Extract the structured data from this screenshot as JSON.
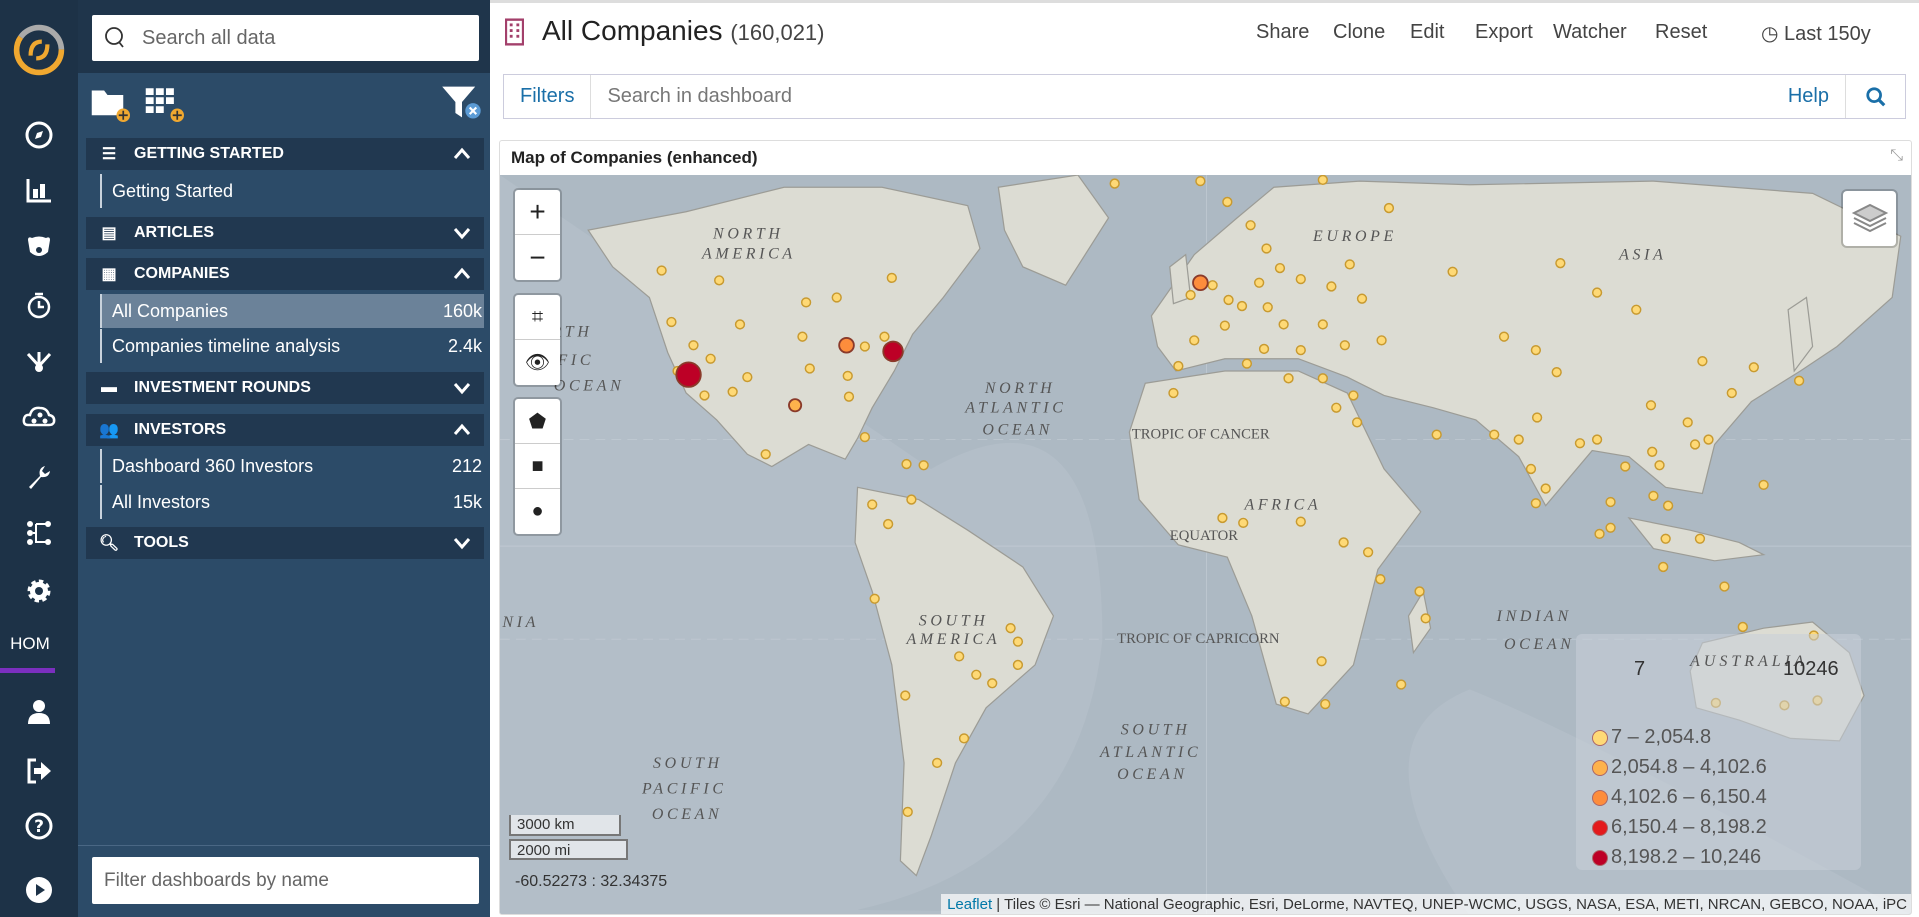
{
  "rail": {
    "logo": "siren-logo",
    "items": [
      "compass-icon",
      "chart-icon",
      "bear-icon",
      "timer-icon",
      "graph-merge-icon",
      "cloud-graph-icon",
      "wrench-icon",
      "network-icon",
      "gear-icon"
    ],
    "home_label": "HOM",
    "bottom": [
      "user-icon",
      "logout-icon",
      "help-icon",
      "play-icon"
    ],
    "accent": "#7b2fbf"
  },
  "sidebar": {
    "search_placeholder": "Search all data",
    "filter_placeholder": "Filter dashboards by name",
    "sections": [
      {
        "title": "GETTING STARTED",
        "expanded": true,
        "items": [
          {
            "label": "Getting Started",
            "count": ""
          }
        ]
      },
      {
        "title": "ARTICLES",
        "expanded": false,
        "items": []
      },
      {
        "title": "COMPANIES",
        "expanded": true,
        "items": [
          {
            "label": "All Companies",
            "count": "160k",
            "selected": true
          },
          {
            "label": "Companies timeline analysis",
            "count": "2.4k"
          }
        ]
      },
      {
        "title": "INVESTMENT ROUNDS",
        "expanded": false,
        "items": []
      },
      {
        "title": "INVESTORS",
        "expanded": true,
        "items": [
          {
            "label": "Dashboard 360 Investors",
            "count": "212"
          },
          {
            "label": "All Investors",
            "count": "15k"
          }
        ]
      },
      {
        "title": "TOOLS",
        "expanded": false,
        "items": []
      }
    ]
  },
  "header": {
    "title": "All Companies",
    "count": "(160,021)",
    "actions": [
      "Share",
      "Clone",
      "Edit",
      "Export",
      "Watcher",
      "Reset"
    ],
    "time": "Last 150y",
    "brand_color": "#a3406b"
  },
  "filterbar": {
    "filters_label": "Filters",
    "placeholder": "Search in dashboard",
    "help_label": "Help"
  },
  "panel": {
    "title": "Map of Companies (enhanced)",
    "map_labels": [
      "NORTH",
      "AMERICA",
      "EUROPE",
      "ASIA",
      "RTH",
      "FIC",
      "OCEAN",
      "NORTH",
      "ATLANTIC",
      "OCEAN",
      "TROPIC OF CANCER",
      "AFRICA",
      "EQUATOR",
      "SOUTH",
      "AMERICA",
      "TROPIC OF CAPRICORN",
      "INDIAN",
      "OCEAN",
      "SOUTH",
      "ATLANTIC",
      "OCEAN",
      "SOUTH",
      "PACIFIC",
      "OCEAN",
      "AUSTRALIA",
      "NIA"
    ],
    "legend": {
      "min": "7",
      "max": "10246",
      "classes": [
        {
          "label": "7 – 2,054.8",
          "color": "#fed976"
        },
        {
          "label": "2,054.8 – 4,102.6",
          "color": "#feb24c"
        },
        {
          "label": "4,102.6 – 6,150.4",
          "color": "#fd8d3c"
        },
        {
          "label": "6,150.4 – 8,198.2",
          "color": "#e31a1c"
        },
        {
          "label": "8,198.2 – 10,246",
          "color": "#bd0026"
        }
      ]
    },
    "scale_km": "3000 km",
    "scale_mi": "2000 mi",
    "coordinates": "-60.52273 : 32.34375",
    "attribution_link": "Leaflet",
    "attribution": " | Tiles © Esri — National Geographic, Esri, DeLorme, NAVTEQ, UNEP-WCMC, USGS, NASA, ESA, METI, NRCAN, GEBCO, NOAA, iPC"
  }
}
